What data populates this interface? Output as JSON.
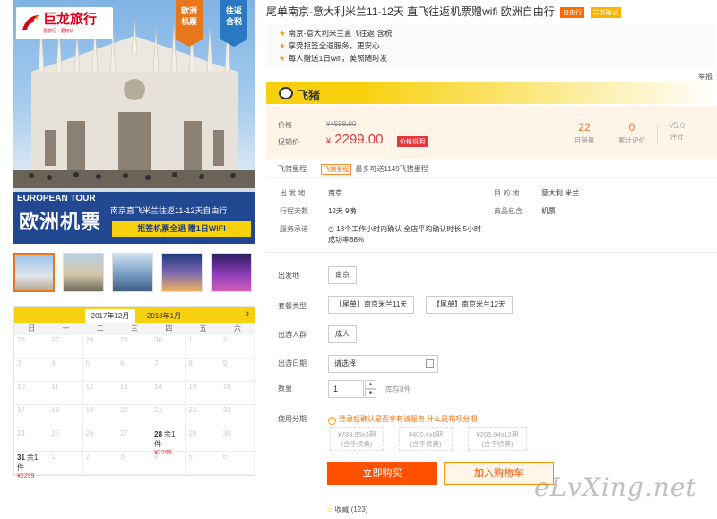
{
  "hero": {
    "logo_name": "巨龙旅行",
    "logo_sub": "惠旅行 · 更好玩",
    "tag_left": "欧洲\n机票",
    "tag_right": "往返\n含税",
    "banner_en": "EUROPEAN TOUR",
    "banner_cn": "欧洲机票",
    "banner_route": "南京直飞米兰往返11-12天自由行",
    "banner_promo": "拒签机票全退  赠1日WIFI"
  },
  "calendar": {
    "tab_active": "2017年12月",
    "tab_next": "2018年1月",
    "weekdays": [
      "日",
      "一",
      "二",
      "三",
      "四",
      "五",
      "六"
    ],
    "cells": [
      "26",
      "27",
      "28",
      "29",
      "30",
      "1",
      "2",
      "3",
      "4",
      "5",
      "6",
      "7",
      "8",
      "9",
      "10",
      "11",
      "12",
      "13",
      "14",
      "15",
      "16",
      "17",
      "18",
      "19",
      "20",
      "21",
      "22",
      "23",
      "24",
      "25",
      "26",
      "27",
      "28",
      "29",
      "30",
      "31",
      "1",
      "2",
      "3",
      "4",
      "5",
      "6"
    ],
    "available": [
      {
        "index": 32,
        "rest": "余1件",
        "price": "¥2299"
      },
      {
        "index": 35,
        "rest": "余1件",
        "price": "¥2299"
      }
    ]
  },
  "product": {
    "title": "尾单南京-意大利米兰11-12天 直飞往返机票赠wifi 欧洲自由行",
    "badge1": "自由行",
    "badge2": "二次确认",
    "features": [
      "南京-意大利米兰直飞往返 含税",
      "享受拒签全退服务，更安心",
      "每人赠送1日wifi，美照随时发"
    ],
    "report": "举报",
    "brand": "飞猪"
  },
  "price": {
    "orig_label": "价格",
    "orig_value": "¥4598.00",
    "cur_label": "促销价",
    "cur_symbol": "¥",
    "cur_value": "2299.00",
    "cur_tag": "价格说明",
    "sales_value": "22",
    "sales_label": "月销量",
    "reviews_value": "0",
    "reviews_label": "累计评价",
    "score_value": "-/5.0",
    "score_label": "评分"
  },
  "mileage": {
    "label": "飞猪里程",
    "tag": "飞猪里程",
    "text": "最多可送1149飞猪里程"
  },
  "info": {
    "depart_label": "出 发 地",
    "depart_value": "南京",
    "dest_label": "目 的 地",
    "dest_value": "意大利  米兰",
    "days_label": "行程天数",
    "days_value": "12天  9晚",
    "include_label": "商品包含",
    "include_value": "机票",
    "service_label": "服务承诺",
    "service_value1": "18个工作小时内确认 全店平均确认时长:5小时",
    "service_value2": "成功率88%"
  },
  "options": {
    "depart_label": "出发地",
    "depart_value": "南京",
    "package_label": "套餐类型",
    "package_1": "【尾单】南京米兰11天",
    "package_2": "【尾单】南京米兰12天",
    "people_label": "出游人群",
    "people_value": "成人",
    "date_label": "出游日期",
    "date_placeholder": "请选择",
    "qty_label": "数量",
    "qty_value": "1",
    "stock": "库存8件",
    "installment_label": "使用分期",
    "installment_note": "登录后确认是否享有该服务",
    "installment_link": "什么是花呗分期",
    "plans": [
      {
        "price": "¥783.95x3期",
        "fee": "(含手续费)"
      },
      {
        "price": "¥400.4x6期",
        "fee": "(含手续费)"
      },
      {
        "price": "¥205.94x12期",
        "fee": "(含手续费)"
      }
    ]
  },
  "actions": {
    "buy": "立即购买",
    "cart": "加入购物车",
    "fav": "收藏",
    "fav_count": "(123)"
  },
  "watermark": "eLvXing.net"
}
